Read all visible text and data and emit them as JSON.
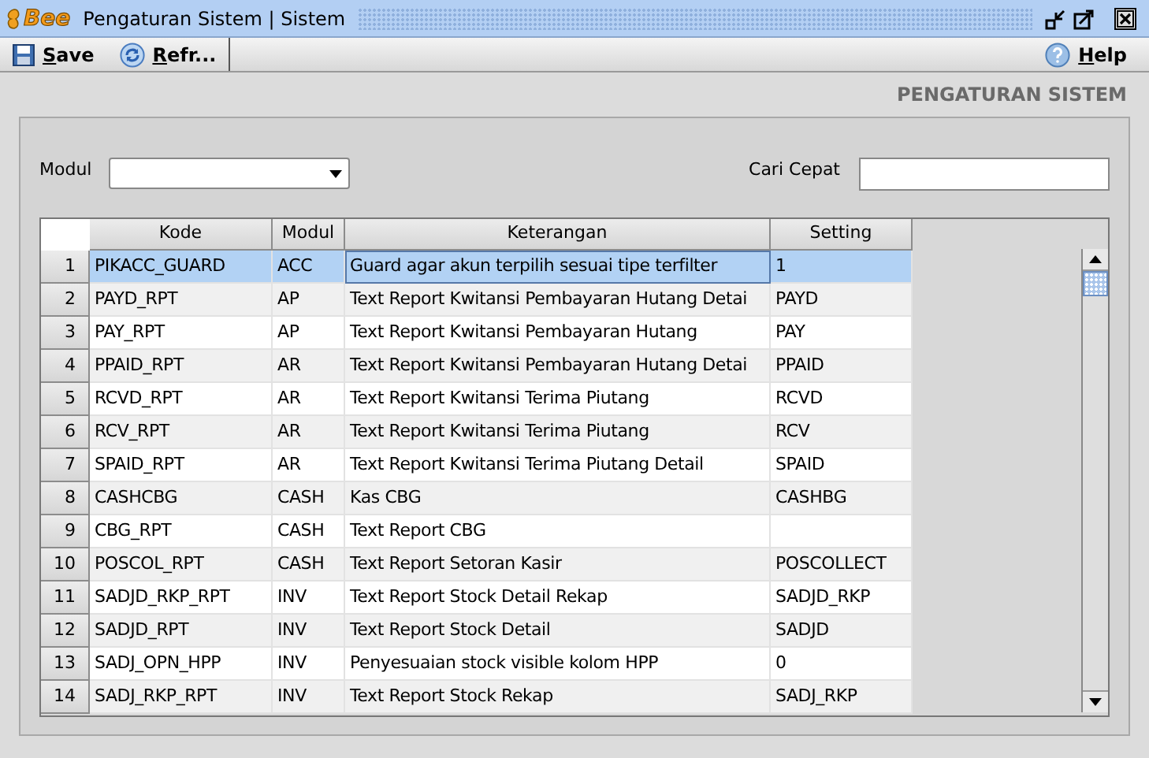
{
  "window": {
    "logo": "Bee",
    "title": "Pengaturan Sistem | Sistem"
  },
  "toolbar": [
    {
      "label": "Save",
      "kind": "save"
    },
    {
      "label": "Refr...",
      "kind": "refresh"
    }
  ],
  "help": {
    "label": "Help"
  },
  "heading": "PENGATURAN SISTEM",
  "filters": {
    "modul_label": "Modul",
    "search_label": "Cari Cepat"
  },
  "table": {
    "columns": [
      "Kode",
      "Modul",
      "Keterangan",
      "Setting"
    ],
    "rows": [
      {
        "no": "1",
        "kode": "PIKACC_GUARD",
        "modul": "ACC",
        "keterangan": "Guard agar akun terpilih sesuai tipe terfilter",
        "setting": "1",
        "selected": true
      },
      {
        "no": "2",
        "kode": "PAYD_RPT",
        "modul": "AP",
        "keterangan": "Text Report Kwitansi Pembayaran Hutang Detai",
        "setting": "PAYD",
        "selected": false
      },
      {
        "no": "3",
        "kode": "PAY_RPT",
        "modul": "AP",
        "keterangan": "Text Report Kwitansi Pembayaran Hutang",
        "setting": "PAY",
        "selected": false
      },
      {
        "no": "4",
        "kode": "PPAID_RPT",
        "modul": "AR",
        "keterangan": "Text Report Kwitansi Pembayaran Hutang Detai",
        "setting": "PPAID",
        "selected": false
      },
      {
        "no": "5",
        "kode": "RCVD_RPT",
        "modul": "AR",
        "keterangan": "Text Report Kwitansi Terima Piutang",
        "setting": "RCVD",
        "selected": false
      },
      {
        "no": "6",
        "kode": "RCV_RPT",
        "modul": "AR",
        "keterangan": "Text Report Kwitansi Terima Piutang",
        "setting": "RCV",
        "selected": false
      },
      {
        "no": "7",
        "kode": "SPAID_RPT",
        "modul": "AR",
        "keterangan": "Text Report Kwitansi Terima Piutang Detail",
        "setting": "SPAID",
        "selected": false
      },
      {
        "no": "8",
        "kode": "CASHCBG",
        "modul": "CASH",
        "keterangan": "Kas CBG",
        "setting": "CASHBG",
        "selected": false
      },
      {
        "no": "9",
        "kode": "CBG_RPT",
        "modul": "CASH",
        "keterangan": "Text Report CBG",
        "selected": false
      },
      {
        "no": "10",
        "kode": "POSCOL_RPT",
        "modul": "CASH",
        "keterangan": "Text Report Setoran Kasir",
        "setting": "POSCOLLECT",
        "selected": false
      },
      {
        "no": "11",
        "kode": "SADJD_RKP_RPT",
        "modul": "INV",
        "keterangan": "Text Report Stock Detail Rekap",
        "setting": "SADJD_RKP",
        "selected": false
      },
      {
        "no": "12",
        "kode": "SADJD_RPT",
        "modul": "INV",
        "keterangan": "Text Report Stock Detail",
        "setting": "SADJD",
        "selected": false
      },
      {
        "no": "13",
        "kode": "SADJ_OPN_HPP",
        "modul": "INV",
        "keterangan": "Penyesuaian stock visible kolom HPP",
        "setting": "0",
        "selected": false
      },
      {
        "no": "14",
        "kode": "SADJ_RKP_RPT",
        "modul": "INV",
        "keterangan": "Text Report Stock Rekap",
        "setting": "SADJ_RKP",
        "selected": false
      }
    ]
  }
}
